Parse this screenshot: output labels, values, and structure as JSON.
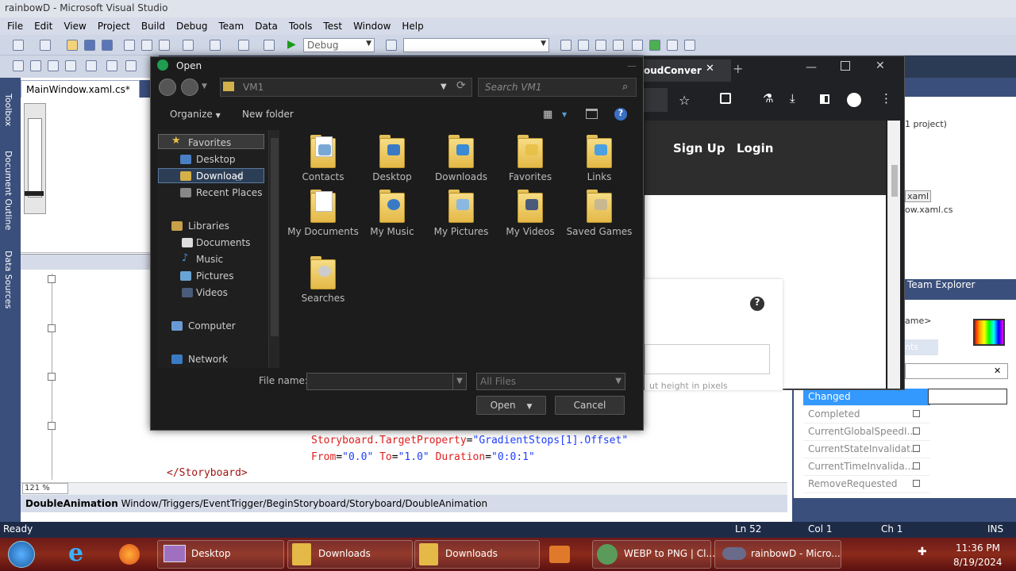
{
  "vs": {
    "title": "rainbowD - Microsoft Visual Studio",
    "menu": [
      "File",
      "Edit",
      "View",
      "Project",
      "Build",
      "Debug",
      "Team",
      "Data",
      "Tools",
      "Test",
      "Window",
      "Help"
    ],
    "config": "Debug",
    "doc_tab": "MainWindow.xaml.cs*",
    "zoom": "121 %",
    "breadcrumb_bold": "DoubleAnimation",
    "breadcrumb_path": "Window/Triggers/EventTrigger/BeginStoryboard/Storyboard/DoubleAnimation",
    "code": {
      "line1_el": "Storyboard.TargetProperty",
      "line1_val": "\"GradientStops[1].Offset\"",
      "line2_a": "From",
      "line2_av": "\"0.0\"",
      "line2_b": "To",
      "line2_bv": "\"1.0\"",
      "line2_c": "Duration",
      "line2_cv": "\"0:0:1\"",
      "line3": "</Storyboard>"
    },
    "left_tabs": [
      "Toolbox",
      "Document Outline",
      "Data Sources"
    ],
    "status": {
      "ready": "Ready",
      "ln": "Ln 52",
      "col": "Col 1",
      "ch": "Ch 1",
      "ins": "INS"
    }
  },
  "right_panel": {
    "solution_line": "1 project)",
    "xaml_item": "xaml",
    "xaml_cs": "ow.xaml.cs",
    "team_explorer": "Team Explorer",
    "name_label": "ame>",
    "events_tab": "nts",
    "events": [
      "Changed",
      "Completed",
      "CurrentGlobalSpeedI...",
      "CurrentStateInvalidat...",
      "CurrentTimeInvalida...",
      "RemoveRequested"
    ]
  },
  "browser": {
    "tab_title": "oudConver",
    "signup": "Sign Up",
    "login": "Login",
    "help_glyph": "?",
    "partial_text": "ut height in pixels"
  },
  "dialog": {
    "title": "Open",
    "path": "VM1",
    "search_placeholder": "Search VM1",
    "organize": "Organize",
    "new_folder": "New folder",
    "nav": {
      "favorites": "Favorites",
      "desktop": "Desktop",
      "downloads": "Download",
      "recent": "Recent Places",
      "libraries": "Libraries",
      "documents": "Documents",
      "music": "Music",
      "pictures": "Pictures",
      "videos": "Videos",
      "computer": "Computer",
      "network": "Network"
    },
    "folders": [
      {
        "label": "Contacts"
      },
      {
        "label": "Desktop"
      },
      {
        "label": "Downloads"
      },
      {
        "label": "Favorites"
      },
      {
        "label": "Links"
      },
      {
        "label": "My Documents"
      },
      {
        "label": "My Music"
      },
      {
        "label": "My Pictures"
      },
      {
        "label": "My Videos"
      },
      {
        "label": "Saved Games"
      },
      {
        "label": "Searches"
      }
    ],
    "filename_label": "File name:",
    "filename_value": "",
    "filter": "All Files",
    "open": "Open",
    "cancel": "Cancel"
  },
  "taskbar": {
    "items": [
      "Desktop",
      "Downloads",
      "Downloads",
      "WEBP to PNG | Cl...",
      "rainbowD - Micro..."
    ],
    "time": "11:36 PM",
    "date": "8/19/2024"
  },
  "colors": {
    "code_red": "#e02020",
    "code_blue": "#2040ff",
    "selected_event": "#3399ff"
  }
}
